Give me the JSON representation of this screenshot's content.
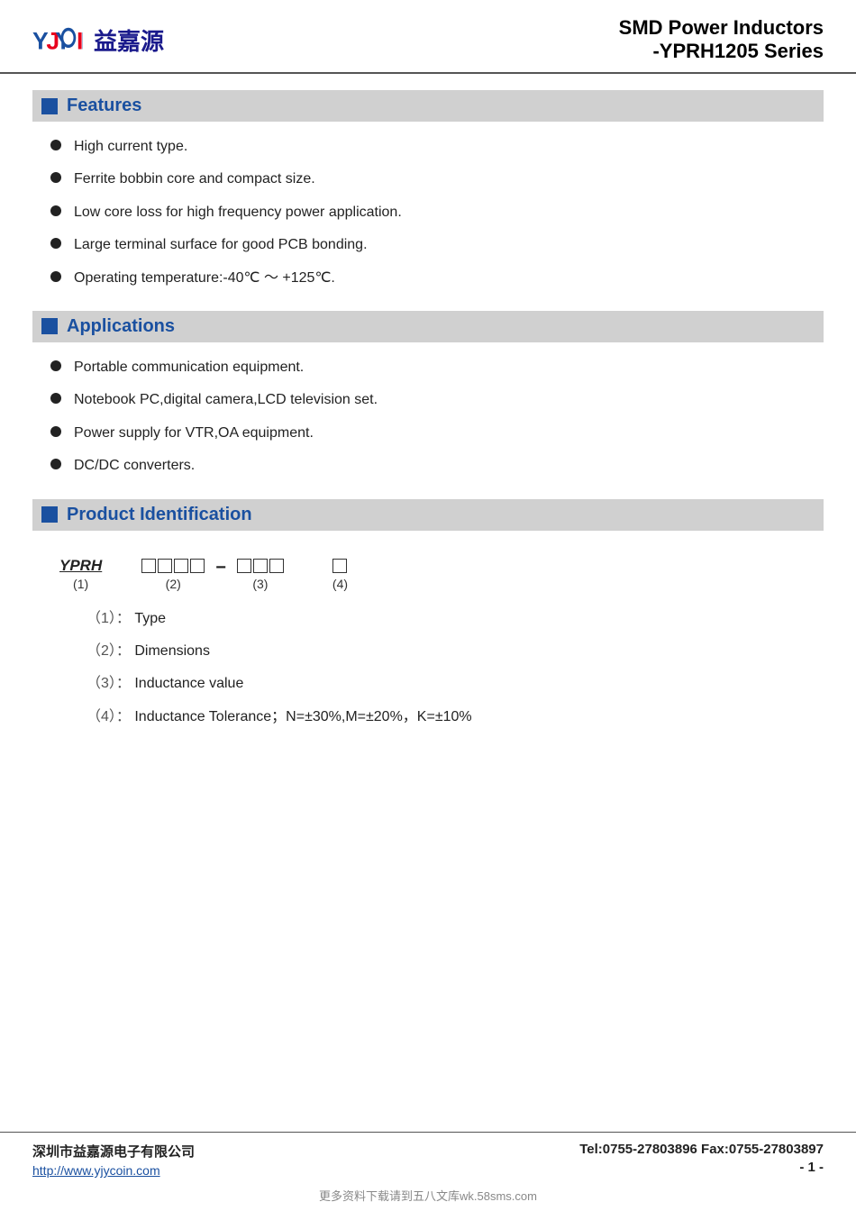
{
  "header": {
    "logo_text_cn": "益嘉源",
    "title_line1": "SMD Power Inductors",
    "title_line2": "-YPRH1205 Series"
  },
  "sections": {
    "features": {
      "title": "Features",
      "items": [
        "High current type.",
        "Ferrite bobbin core and compact size.",
        "Low core loss for high frequency power application.",
        "Large terminal surface for good PCB bonding.",
        "Operating temperature:-40℃ ～ +125℃."
      ]
    },
    "applications": {
      "title": "Applications",
      "items": [
        "Portable communication equipment.",
        "Notebook PC,digital camera,LCD television set.",
        "Power supply for VTR,OA equipment.",
        "DC/DC converters."
      ]
    },
    "product_id": {
      "title": "Product Identification",
      "code": "YPRH",
      "label1": "(1)",
      "label2": "(2)",
      "label3": "(3)",
      "label4": "(4)",
      "desc1_num": "（1）：",
      "desc1_text": "Type",
      "desc2_num": "（2）：",
      "desc2_text": "Dimensions",
      "desc3_num": "（3）：",
      "desc3_text": "Inductance value",
      "desc4_num": "（4）：",
      "desc4_text": "Inductance Tolerance；N=±30%,M=±20%，K=±10%"
    }
  },
  "footer": {
    "company": "深圳市益嘉源电子有限公司",
    "url": "http://www.yjycoin.com",
    "contact": "Tel:0755-27803896   Fax:0755-27803897",
    "page": "- 1 -",
    "watermark": "更多资料下载请到五八文库wk.58sms.com"
  }
}
